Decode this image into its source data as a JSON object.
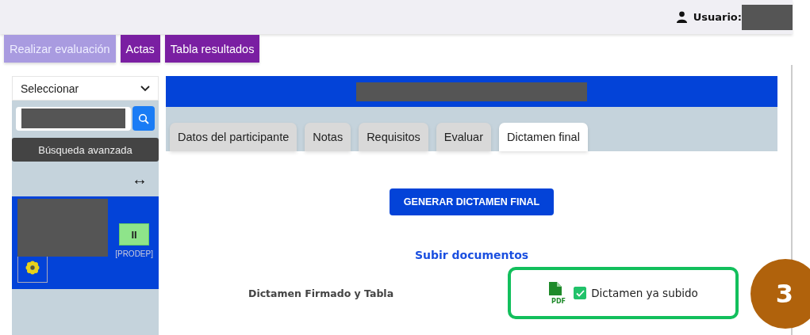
{
  "header": {
    "user_label": "Usuario:"
  },
  "nav_tabs": [
    {
      "label": "Realizar evaluación",
      "selected": true
    },
    {
      "label": "Actas",
      "selected": false
    },
    {
      "label": "Tabla resultados",
      "selected": false
    }
  ],
  "sidebar": {
    "select": {
      "value": "Seleccionar"
    },
    "advanced_search": "Búsqueda avanzada",
    "resize_glyph": "↔",
    "card": {
      "pause_label": "II",
      "program": "[PRODEP]"
    }
  },
  "panel": {
    "tabs": [
      {
        "label": "Datos del participante",
        "selected": false
      },
      {
        "label": "Notas",
        "selected": false
      },
      {
        "label": "Requisitos",
        "selected": false
      },
      {
        "label": "Evaluar",
        "selected": false
      },
      {
        "label": "Dictamen final",
        "selected": true
      }
    ],
    "generate_button": "GENERAR DICTAMEN FINAL",
    "upload_heading": "Subir documentos",
    "document": {
      "label": "Dictamen Firmado y Tabla",
      "file_type": "PDF",
      "uploaded": true,
      "status": "Dictamen ya subido"
    }
  },
  "annotation": {
    "step": "3"
  }
}
